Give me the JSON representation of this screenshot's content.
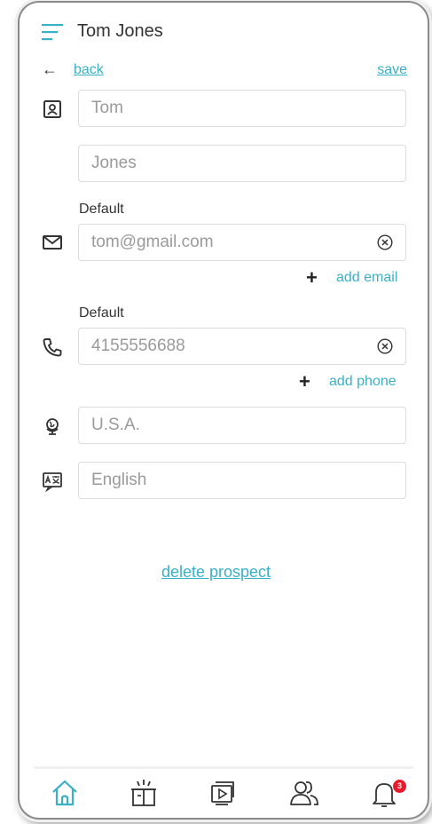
{
  "header": {
    "title": "Tom Jones"
  },
  "nav": {
    "back_label": "back",
    "save_label": "save"
  },
  "fields": {
    "first_name": "Tom",
    "last_name": "Jones",
    "email_label": "Default",
    "email": "tom@gmail.com",
    "add_email": "add email",
    "phone_label": "Default",
    "phone": "4155556688",
    "add_phone": "add phone",
    "country": "U.S.A.",
    "language": "English"
  },
  "actions": {
    "delete_label": "delete prospect"
  },
  "tabbar": {
    "items": [
      "home-icon",
      "gift-icon",
      "media-icon",
      "contacts-icon",
      "bell-icon"
    ],
    "notification_count": "3"
  },
  "colors": {
    "accent": "#3ab0c4",
    "badge": "#e61b2c"
  }
}
